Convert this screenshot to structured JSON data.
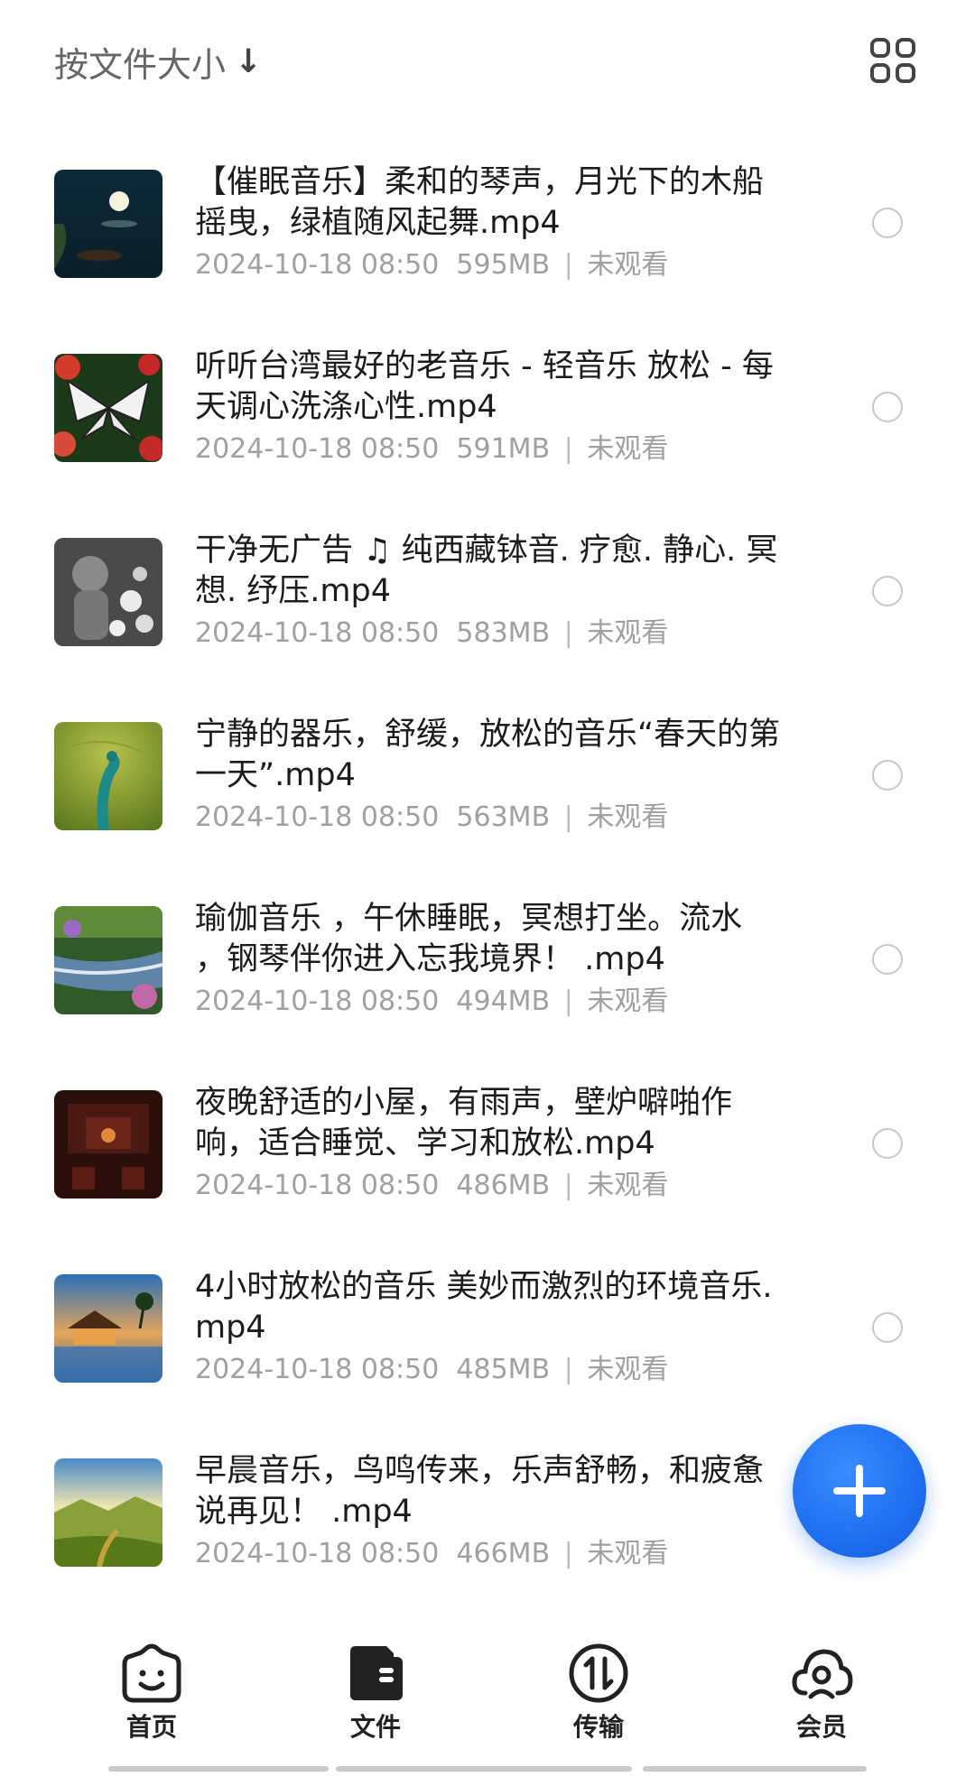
{
  "header": {
    "sort_label": "按文件大小",
    "sort_arrow": "↓",
    "view_toggle_icon": "grid-view-icon"
  },
  "files": [
    {
      "title": "【催眠音乐】柔和的琴声，月光下的木船摇曳，绿植随风起舞.mp4",
      "date": "2024-10-18 08:50",
      "size": "595MB",
      "status": "未观看",
      "thumb": "moon-lake"
    },
    {
      "title": "听听台湾最好的老音乐 - 轻音乐 放松 - 每天调心洗涤心性.mp4",
      "date": "2024-10-18 08:50",
      "size": "591MB",
      "status": "未观看",
      "thumb": "butterfly"
    },
    {
      "title": "干净无广告 ♫ 纯西藏钵音. 疗愈. 静心. 冥想. 纾压.mp4",
      "date": "2024-10-18 08:50",
      "size": "583MB",
      "status": "未观看",
      "thumb": "buddha"
    },
    {
      "title": "宁静的器乐，舒缓，放松的音乐“春天的第一天”.mp4",
      "date": "2024-10-18 08:50",
      "size": "563MB",
      "status": "未观看",
      "thumb": "peacock"
    },
    {
      "title": "瑜伽音乐 ，午休睡眠，冥想打坐。流水 ，钢琴伴你进入忘我境界！ .mp4",
      "date": "2024-10-18 08:50",
      "size": "494MB",
      "status": "未观看",
      "thumb": "stream"
    },
    {
      "title": "夜晚舒适的小屋，有雨声，壁炉噼啪作响，适合睡觉、学习和放松.mp4",
      "date": "2024-10-18 08:50",
      "size": "486MB",
      "status": "未观看",
      "thumb": "cabin"
    },
    {
      "title": "4小时放松的音乐 美妙而激烈的环境音乐.mp4",
      "date": "2024-10-18 08:50",
      "size": "485MB",
      "status": "未观看",
      "thumb": "resort"
    },
    {
      "title": "早晨音乐，鸟鸣传来，乐声舒畅，和疲惫说再见！ .mp4",
      "date": "2024-10-18 08:50",
      "size": "466MB",
      "status": "未观看",
      "thumb": "valley"
    }
  ],
  "separator": "|",
  "fab": {
    "icon": "plus-icon"
  },
  "nav": [
    {
      "label": "首页",
      "icon": "home-smile-icon"
    },
    {
      "label": "文件",
      "icon": "folder-wallet-icon"
    },
    {
      "label": "传输",
      "icon": "transfer-arrows-icon"
    },
    {
      "label": "会员",
      "icon": "cloud-member-icon"
    }
  ]
}
